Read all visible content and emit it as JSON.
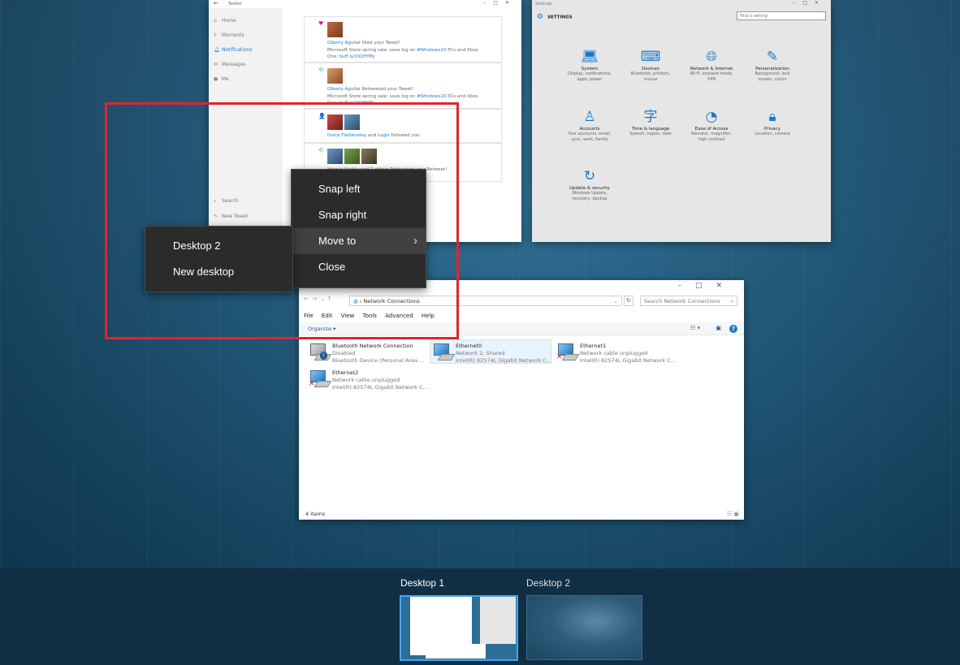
{
  "twitter": {
    "title": "Twitter",
    "nav": [
      "Home",
      "Moments",
      "Notifications",
      "Messages",
      "Me"
    ],
    "bottom_nav": [
      "Search",
      "New Tweet"
    ],
    "notifications": [
      {
        "mark": "♥",
        "user": "Olberly Aguilar",
        "action": "liked your Tweet!",
        "line2": "Microsoft Store spring sale: save big on",
        "hashtag": "#Windows10",
        "line2b": "PCs and Xbox",
        "line3": "One:",
        "link": "buff.ly/2iQHYMy"
      },
      {
        "mark": "⟲",
        "user": "Olberly Aguilar",
        "action": "Retweeted your Tweet!",
        "line2": "Microsoft Store spring sale: save big on",
        "hashtag": "#Windows10",
        "line2b": "PCs and Xbox",
        "line3": "One:",
        "link": "buff.ly/2iQHYMy"
      },
      {
        "mark": "👤",
        "user": "Dolce Flattersday",
        "action": "followed you.",
        "user2": "Logix",
        "and": "and"
      },
      {
        "mark": "⟲",
        "text": "Hannie Vackle and 2 others Retweeted your Retweet!"
      }
    ]
  },
  "settings": {
    "title": "Settings",
    "header": "SETTINGS",
    "search_placeholder": "Find a setting",
    "tiles": [
      {
        "name": "System",
        "desc": [
          "Display, notifications,",
          "apps, power"
        ]
      },
      {
        "name": "Devices",
        "desc": [
          "Bluetooth, printers,",
          "mouse"
        ]
      },
      {
        "name": "Network & Internet",
        "desc": [
          "Wi-Fi, airplane mode,",
          "VPN"
        ]
      },
      {
        "name": "Personalization",
        "desc": [
          "Background, lock",
          "screen, colors"
        ]
      },
      {
        "name": "Accounts",
        "desc": [
          "Your accounts, email,",
          "sync, work, family"
        ]
      },
      {
        "name": "Time & language",
        "desc": [
          "Speech, region, date"
        ]
      },
      {
        "name": "Ease of Access",
        "desc": [
          "Narrator, magnifier,",
          "high contrast"
        ]
      },
      {
        "name": "Privacy",
        "desc": [
          "Location, camera"
        ]
      },
      {
        "name": "Update & security",
        "desc": [
          "Windows Update,",
          "recovery, backup"
        ]
      }
    ]
  },
  "network": {
    "breadcrumb": "Network Connections",
    "search_placeholder": "Search Network Connections",
    "menu": [
      "File",
      "Edit",
      "View",
      "Tools",
      "Advanced",
      "Help"
    ],
    "organize": "Organize ▾",
    "adapters": [
      {
        "name": "Bluetooth Network Connection",
        "status": "Disabled",
        "device": "Bluetooth Device (Personal Area ..."
      },
      {
        "name": "Ethernet0",
        "status": "Network  2, Shared",
        "device": "Intel(R) 82574L Gigabit Network C..."
      },
      {
        "name": "Ethernet1",
        "status": "Network cable unplugged",
        "device": "Intel(R) 82574L Gigabit Network C..."
      },
      {
        "name": "Ethernet2",
        "status": "Network cable unplugged",
        "device": "Intel(R) 82574L Gigabit Network C..."
      }
    ],
    "status": "4 items"
  },
  "context_menu": {
    "items": [
      "Snap left",
      "Snap right",
      "Move to",
      "Close"
    ],
    "submenu": [
      "Desktop 2",
      "New desktop"
    ]
  },
  "desktops": {
    "items": [
      {
        "label": "Desktop 1",
        "current": true
      },
      {
        "label": "Desktop 2",
        "current": false
      }
    ]
  },
  "colors": {
    "accent": "#1b7ac9",
    "highlight": "#e0252d",
    "menu_bg": "#2b2b2b",
    "taskview_bar": "#102f44"
  }
}
